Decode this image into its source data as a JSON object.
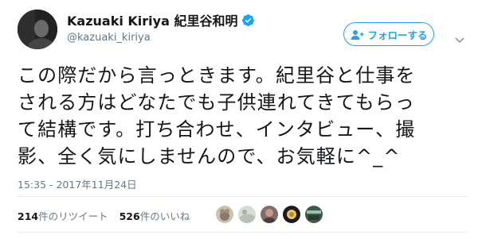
{
  "tweet": {
    "author": {
      "display_name": "Kazuaki Kiriya 紀里谷和明",
      "handle": "@kazuaki_kiriya",
      "verified": true
    },
    "follow_button": {
      "label": "フォローする",
      "icon": "add-user-icon"
    },
    "menu_icon": "chevron-down-icon",
    "text_lines": [
      "この際だから言っときます。紀里谷と仕事を",
      "される方はどなたでも子供連れてきてもらっ",
      "て結構です。打ち合わせ、インタビュー、撮",
      "影、全く気にしませんので、お気軽に^_^"
    ],
    "timestamp": "15:35 - 2017年11月24日",
    "stats": {
      "retweets_count": "214",
      "retweets_label": "件のリツイート",
      "likes_count": "526",
      "likes_label": "件のいいね"
    },
    "colors": {
      "accent": "#1da1f2",
      "secondary_text": "#657786",
      "divider": "#e6ecf0"
    }
  }
}
